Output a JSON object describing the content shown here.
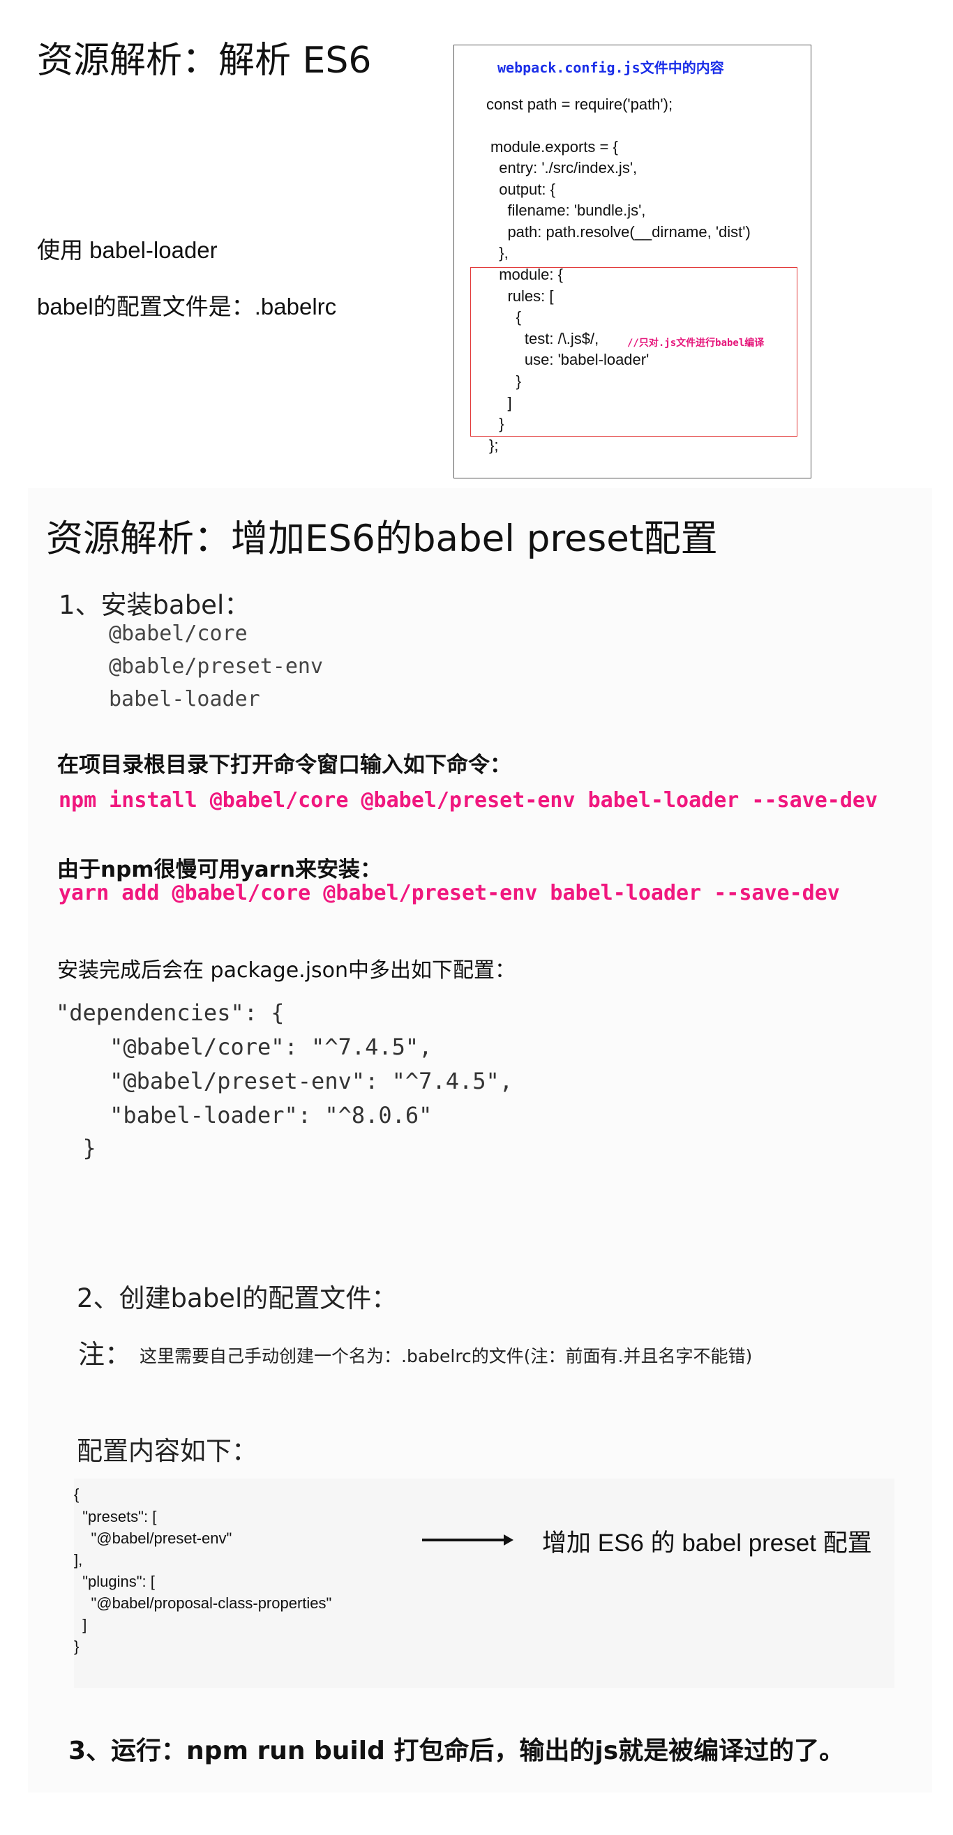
{
  "slide1": {
    "title": "资源解析：解析 ES6",
    "line1": "使用 babel-loader",
    "line2": "babel的配置文件是：.babelrc",
    "code_box": {
      "heading": "webpack.config.js文件中的内容",
      "lines": [
        "const path = require('path');",
        "module.exports = {",
        "  entry: './src/index.js',",
        "  output: {",
        "    filename: 'bundle.js',",
        "    path: path.resolve(__dirname, 'dist')",
        "  },",
        "  module: {",
        "    rules: [",
        "      {",
        "        test: /\\.js$/,",
        "        use: 'babel-loader'",
        "      }",
        "    ]",
        "  }",
        "};"
      ],
      "comment": "//只对.js文件进行babel编译"
    }
  },
  "slide2": {
    "title": "资源解析：增加ES6的babel preset配置",
    "step1": {
      "heading": "1、安装babel：",
      "packages": [
        "@babel/core",
        "@bable/preset-env",
        "babel-loader"
      ],
      "instruction": "在项目录根目录下打开命令窗口输入如下命令：",
      "npm_cmd": "npm install @babel/core @babel/preset-env babel-loader --save-dev",
      "yarn_note": "由于npm很慢可用yarn来安装：",
      "yarn_cmd": "yarn add @babel/core @babel/preset-env babel-loader --save-dev",
      "after_note": "安装完成后会在 package.json中多出如下配置：",
      "deps": [
        "\"dependencies\": {",
        "    \"@babel/core\": \"^7.4.5\",",
        "    \"@babel/preset-env\": \"^7.4.5\",",
        "    \"babel-loader\": \"^8.0.6\"",
        "  }"
      ]
    },
    "step2": {
      "heading": "2、创建babel的配置文件：",
      "note_label": "注：",
      "note_text": "这里需要自己手动创建一个名为：.babelrc的文件(注：前面有.并且名字不能错)",
      "config_heading": "配置内容如下：",
      "config_lines": [
        "{",
        "  \"presets\": [",
        "    \"@babel/preset-env\"",
        "],",
        "  \"plugins\": [",
        "    \"@babel/proposal-class-properties\"",
        "  ]",
        "}"
      ],
      "arrow_label": "增加 ES6 的 babel preset 配置"
    },
    "step3": "3、运行：npm run build 打包命后，输出的js就是被编译过的了。"
  }
}
